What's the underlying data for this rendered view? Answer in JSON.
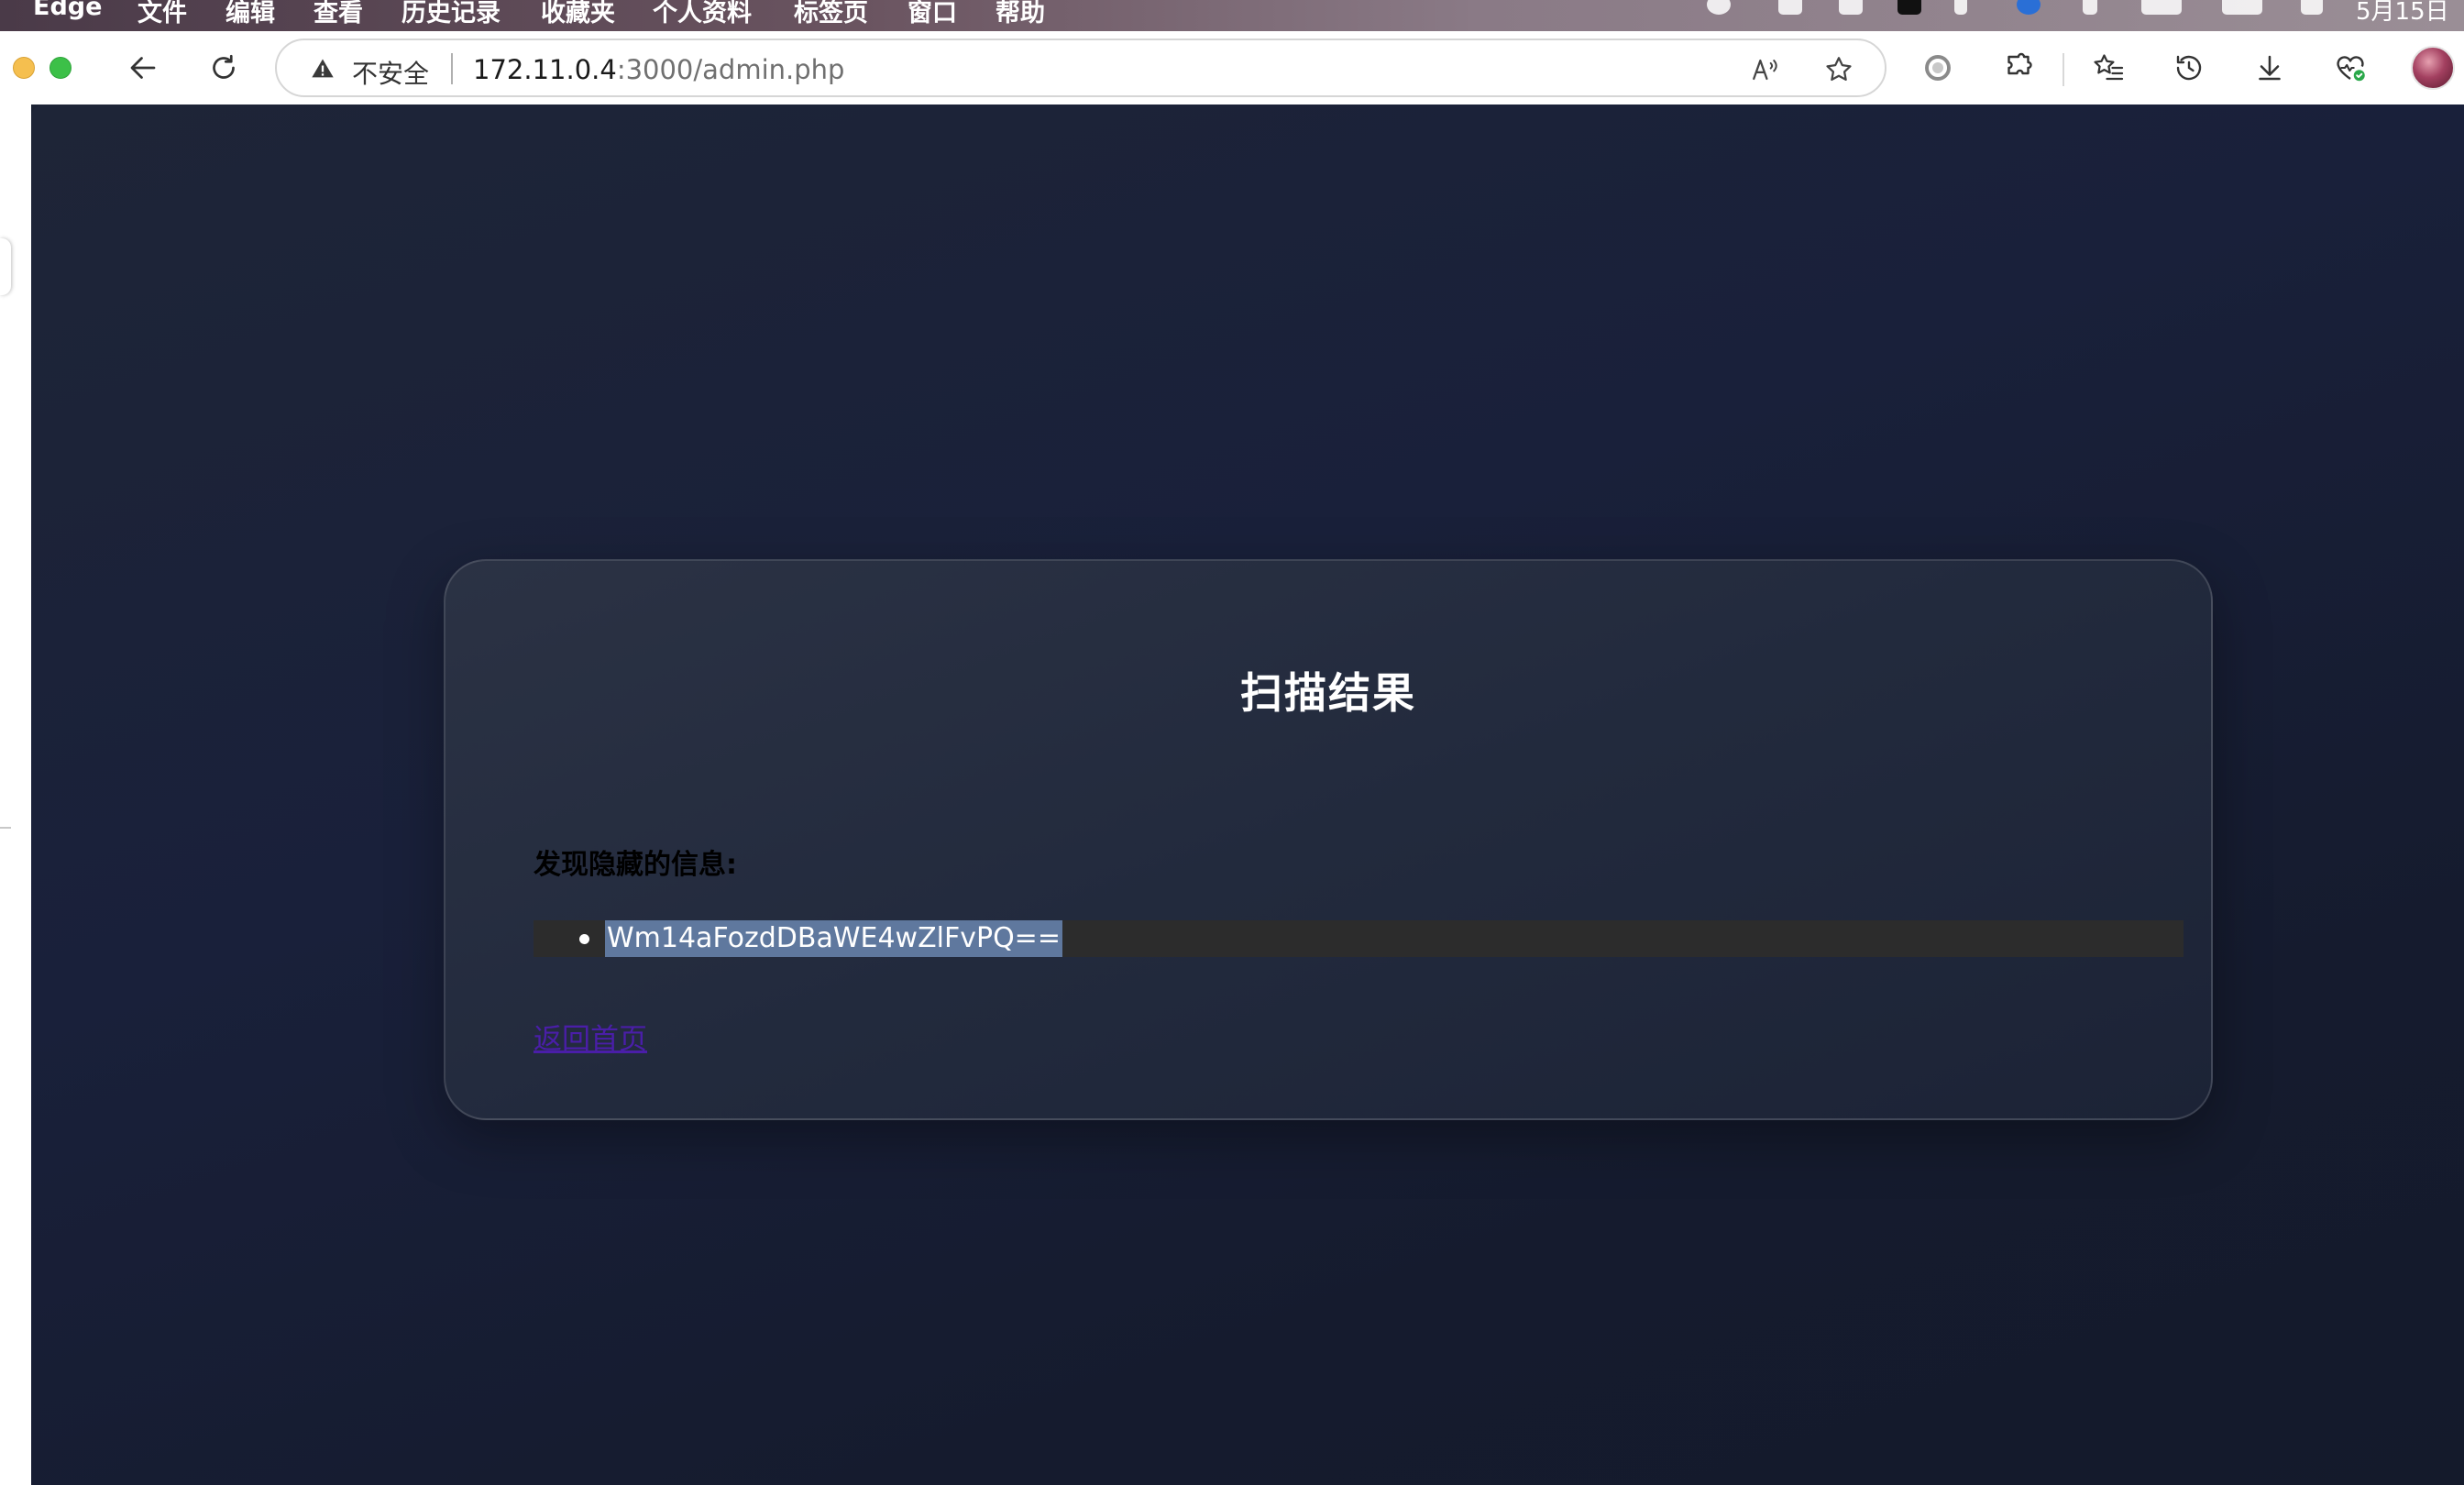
{
  "menubar": {
    "app": "Edge",
    "items": [
      "文件",
      "编辑",
      "查看",
      "历史记录",
      "收藏夹",
      "个人资料",
      "标签页",
      "窗口",
      "帮助"
    ],
    "clock": "5月15日"
  },
  "browser": {
    "security_label": "不安全",
    "url_host": "172.11.0.4",
    "url_rest": ":3000/admin.php",
    "icons": [
      "back-arrow-icon",
      "reload-icon",
      "warning-triangle-icon",
      "read-aloud-icon",
      "favorite-star-icon",
      "record-icon",
      "extensions-puzzle-icon",
      "favorites-list-icon",
      "history-clock-icon",
      "download-icon",
      "browser-essentials-heart-icon",
      "profile-avatar"
    ]
  },
  "page": {
    "title": "扫描结果",
    "found_label": "发现隐藏的信息:",
    "results": [
      "Wm14aFozdDBaWE4wZlFvPQ=="
    ],
    "home_link": "返回首页"
  },
  "colors": {
    "page_bg": "#1b2233",
    "card_bg": "#262d3f",
    "selection": "#5f789e",
    "link": "#4a1ea8"
  }
}
